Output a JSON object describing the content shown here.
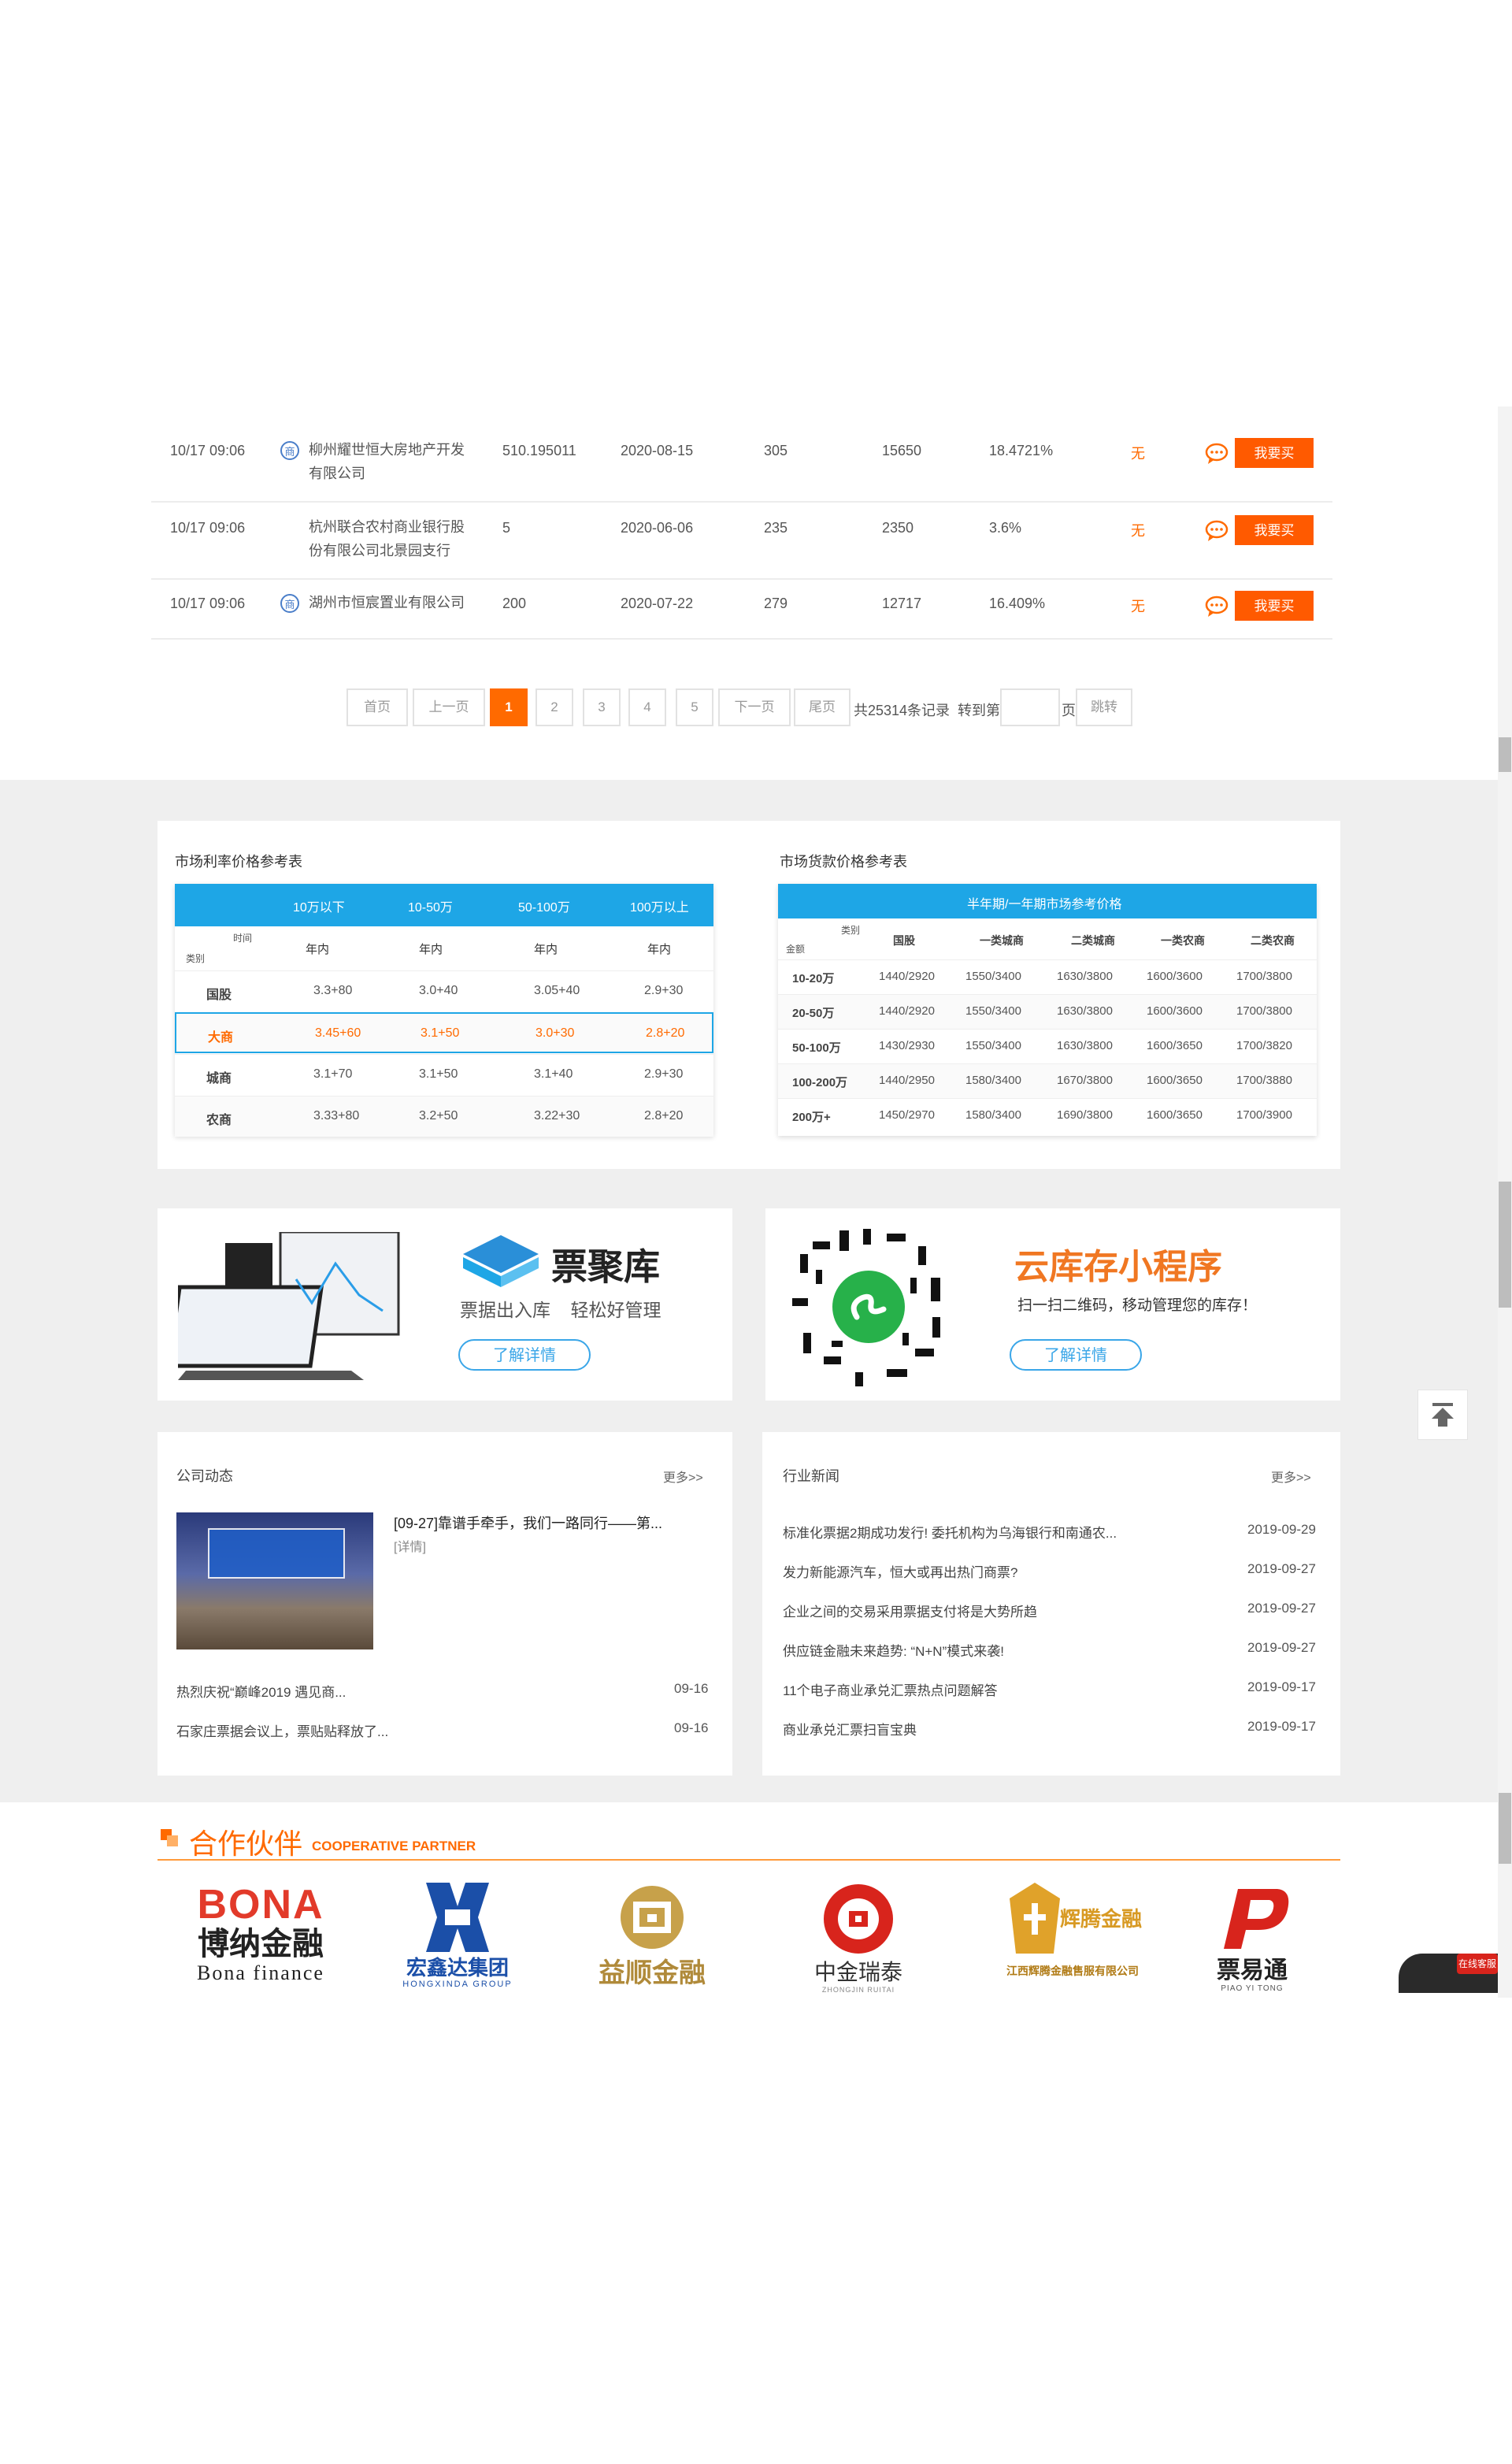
{
  "colors": {
    "accent": "#ff6a00",
    "blue": "#1ea6e6",
    "gray_band": "#efefef"
  },
  "bill_rows": [
    {
      "time": "10/17 09:06",
      "has_badge": true,
      "acceptor": "柳州耀世恒大房地产开发有限公司",
      "amount": "510.195011",
      "due_date": "2020-08-15",
      "days": "305",
      "deduction": "15650",
      "rate": "18.4721%",
      "flaw": "无",
      "buy": "我要买"
    },
    {
      "time": "10/17 09:06",
      "has_badge": false,
      "acceptor": "杭州联合农村商业银行股份有限公司北景园支行",
      "amount": "5",
      "due_date": "2020-06-06",
      "days": "235",
      "deduction": "2350",
      "rate": "3.6%",
      "flaw": "无",
      "buy": "我要买"
    },
    {
      "time": "10/17 09:06",
      "has_badge": true,
      "acceptor": "湖州市恒宸置业有限公司",
      "amount": "200",
      "due_date": "2020-07-22",
      "days": "279",
      "deduction": "12717",
      "rate": "16.409%",
      "flaw": "无",
      "buy": "我要买"
    }
  ],
  "badge_char": "商",
  "pagination": {
    "first": "首页",
    "prev": "上一页",
    "pages": [
      "1",
      "2",
      "3",
      "4",
      "5"
    ],
    "current": "1",
    "next": "下一页",
    "last": "尾页",
    "total": "共25314条记录",
    "goto": "转到第",
    "page_unit": "页",
    "jump": "跳转"
  },
  "rate_table": {
    "title": "市场利率价格参考表",
    "headers": [
      "10万以下",
      "10-50万",
      "50-100万",
      "100万以上"
    ],
    "corner_top": "时间",
    "corner_bottom": "类别",
    "subheader": [
      "年内",
      "年内",
      "年内",
      "年内"
    ],
    "rows": [
      {
        "label": "国股",
        "values": [
          "3.3+80",
          "3.0+40",
          "3.05+40",
          "2.9+30"
        ],
        "highlight": false
      },
      {
        "label": "大商",
        "values": [
          "3.45+60",
          "3.1+50",
          "3.0+30",
          "2.8+20"
        ],
        "highlight": true
      },
      {
        "label": "城商",
        "values": [
          "3.1+70",
          "3.1+50",
          "3.1+40",
          "2.9+30"
        ],
        "highlight": false
      },
      {
        "label": "农商",
        "values": [
          "3.33+80",
          "3.2+50",
          "3.22+30",
          "2.8+20"
        ],
        "highlight": false
      }
    ]
  },
  "loan_table": {
    "title": "市场货款价格参考表",
    "header": "半年期/一年期市场参考价格",
    "corner_top": "类别",
    "corner_bottom": "金额",
    "columns": [
      "国股",
      "一类城商",
      "二类城商",
      "一类农商",
      "二类农商"
    ],
    "rows": [
      {
        "label": "10-20万",
        "values": [
          "1440/2920",
          "1550/3400",
          "1630/3800",
          "1600/3600",
          "1700/3800"
        ]
      },
      {
        "label": "20-50万",
        "values": [
          "1440/2920",
          "1550/3400",
          "1630/3800",
          "1600/3600",
          "1700/3800"
        ]
      },
      {
        "label": "50-100万",
        "values": [
          "1430/2930",
          "1550/3400",
          "1630/3800",
          "1600/3650",
          "1700/3820"
        ]
      },
      {
        "label": "100-200万",
        "values": [
          "1440/2950",
          "1580/3400",
          "1670/3800",
          "1600/3650",
          "1700/3880"
        ]
      },
      {
        "label": "200万+",
        "values": [
          "1450/2970",
          "1580/3400",
          "1690/3800",
          "1600/3650",
          "1700/3900"
        ]
      }
    ]
  },
  "promo_left": {
    "brand": "票聚库",
    "slogan": "票据出入库    轻松好管理",
    "button": "了解详情"
  },
  "promo_right": {
    "title": "云库存小程序",
    "desc": "扫一扫二维码，移动管理您的库存！",
    "button": "了解详情"
  },
  "company_news": {
    "title": "公司动态",
    "more": "更多>>",
    "feature_title": "[09-27]靠谱手牵手，我们一路同行——第...",
    "feature_detail": "[详情]",
    "items": [
      {
        "text": "热烈庆祝“巅峰2019 遇见商...",
        "date": "09-16"
      },
      {
        "text": "石家庄票据会议上，票贴贴释放了...",
        "date": "09-16"
      }
    ]
  },
  "industry_news": {
    "title": "行业新闻",
    "more": "更多>>",
    "items": [
      {
        "text": "标准化票据2期成功发行! 委托机构为乌海银行和南通农...",
        "date": "2019-09-29"
      },
      {
        "text": "发力新能源汽车，恒大或再出热门商票?",
        "date": "2019-09-27"
      },
      {
        "text": "企业之间的交易采用票据支付将是大势所趋",
        "date": "2019-09-27"
      },
      {
        "text": "供应链金融未来趋势: “N+N”模式来袭!",
        "date": "2019-09-27"
      },
      {
        "text": "11个电子商业承兑汇票热点问题解答",
        "date": "2019-09-17"
      },
      {
        "text": "商业承兑汇票扫盲宝典",
        "date": "2019-09-17"
      }
    ]
  },
  "partners": {
    "title": "合作伙伴",
    "subtitle": "COOPERATIVE PARTNER",
    "logos": [
      {
        "mark": "BONA",
        "name": "博纳金融",
        "sub": "Bona finance"
      },
      {
        "name": "宏鑫达集团",
        "sub": "HONGXINDA GROUP"
      },
      {
        "name": "益顺金融"
      },
      {
        "name": "中金瑞泰",
        "sub": "ZHONGJIN RUITAI"
      },
      {
        "name": "辉腾金融",
        "sub": "江西辉腾金融售服有限公司"
      },
      {
        "name": "票易通",
        "sub": "PIAO YI TONG"
      }
    ]
  },
  "float": {
    "badge": "在线客服"
  }
}
